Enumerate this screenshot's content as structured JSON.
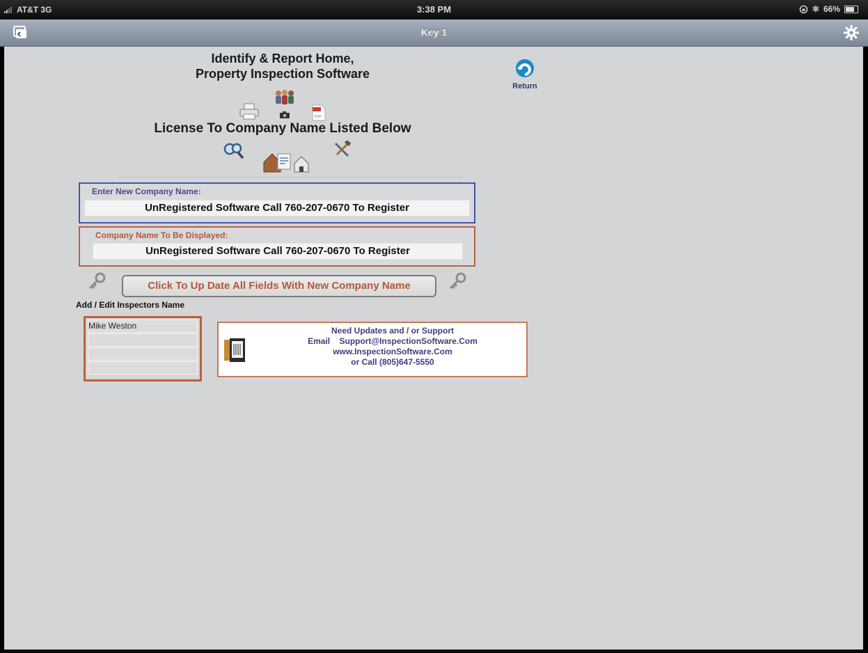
{
  "status_bar": {
    "carrier": "AT&T 3G",
    "time": "3:38 PM",
    "battery": "66%",
    "battery_level": 0.66,
    "signal_icon": "signal-bars-icon",
    "lock_icon": "rotation-lock-icon",
    "bluetooth_icon": "bluetooth-icon"
  },
  "nav_bar": {
    "title": "Key 1",
    "left_icon": "tabs-icon",
    "right_icon": "gear-icon"
  },
  "header": {
    "title_line1": "Identify & Report Home,",
    "title_line2": "Property Inspection Software",
    "license_title": "License To Company Name Listed Below",
    "return_label": "Return",
    "icons": [
      "people-icon",
      "printer-icon",
      "camera-icon",
      "pdf-icon",
      "magnifier-icon",
      "houses-icon",
      "tools-icon"
    ]
  },
  "company": {
    "new_name_label": "Enter New Company Name:",
    "new_name_value": "UnRegistered Software Call 760-207-0670 To Register",
    "displayed_label": "Company Name To Be Displayed:",
    "displayed_value": "UnRegistered Software Call 760-207-0670 To Register",
    "update_button": "Click To Up Date All Fields With New Company Name"
  },
  "inspectors": {
    "label": "Add / Edit Inspectors Name",
    "names": [
      "Mike Weston",
      "",
      "",
      ""
    ]
  },
  "support": {
    "line1": "Need Updates and / or Support",
    "email_label": "Email",
    "email": "Support@InspectionSoftware.Com",
    "website": "www.InspectionSoftware.Com",
    "phone": "or Call (805)647-5550"
  },
  "colors": {
    "background": "#d4d5d7",
    "blue_border": "#3e59a8",
    "orange_border": "#b8613f",
    "accent_text": "#b5583a",
    "support_text": "#3d3d80"
  }
}
